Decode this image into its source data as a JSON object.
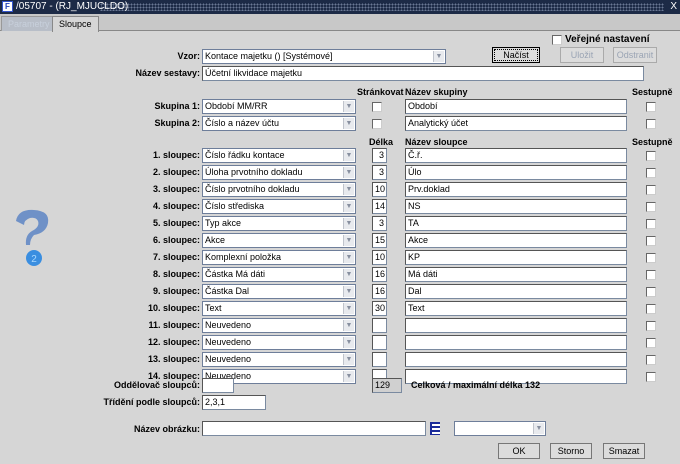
{
  "window": {
    "title": "/05707 - (RJ_MJUCLDO)",
    "icon": "app-logo",
    "close": "X"
  },
  "tabs": [
    {
      "label": "Parametry",
      "active": false
    },
    {
      "label": "Sloupce",
      "active": true
    }
  ],
  "public": {
    "label": "Veřejné nastavení",
    "checked": false
  },
  "vzor": {
    "label": "Vzor:",
    "value": "Kontace majetku   ()   [Systémové]"
  },
  "buttons": {
    "load": "Načíst",
    "save": "Uložit",
    "delete": "Odstranit",
    "ok": "OK",
    "cancel": "Storno",
    "clear": "Smazat"
  },
  "report_name": {
    "label": "Název sestavy:",
    "value": "Účetní likvidace majetku"
  },
  "group_headers": {
    "paginate": "Stránkovat",
    "group_name": "Název skupiny",
    "descending": "Sestupně"
  },
  "groups": [
    {
      "label": "Skupina 1:",
      "value": "Období MM/RR",
      "name": "Období"
    },
    {
      "label": "Skupina 2:",
      "value": "Číslo a název účtu",
      "name": "Analytický účet"
    }
  ],
  "column_headers": {
    "length": "Délka",
    "column_name": "Název sloupce",
    "descending": "Sestupně"
  },
  "columns": [
    {
      "label": "1. sloupec:",
      "value": "Číslo řádku kontace",
      "length": "3",
      "name": "Č.ř."
    },
    {
      "label": "2. sloupec:",
      "value": "Úloha prvotního dokladu",
      "length": "3",
      "name": "Úlo"
    },
    {
      "label": "3. sloupec:",
      "value": "Číslo prvotního dokladu",
      "length": "10",
      "name": "Prv.doklad"
    },
    {
      "label": "4. sloupec:",
      "value": "Číslo střediska",
      "length": "14",
      "name": "NS"
    },
    {
      "label": "5. sloupec:",
      "value": "Typ akce",
      "length": "3",
      "name": "TA"
    },
    {
      "label": "6. sloupec:",
      "value": "Akce",
      "length": "15",
      "name": "Akce"
    },
    {
      "label": "7. sloupec:",
      "value": "Komplexní položka",
      "length": "10",
      "name": "KP"
    },
    {
      "label": "8. sloupec:",
      "value": "Částka Má dáti",
      "length": "16",
      "name": "Má dáti"
    },
    {
      "label": "9. sloupec:",
      "value": "Částka Dal",
      "length": "16",
      "name": "Dal"
    },
    {
      "label": "10. sloupec:",
      "value": "Text",
      "length": "30",
      "name": "Text"
    },
    {
      "label": "11. sloupec:",
      "value": "Neuvedeno",
      "length": "",
      "name": ""
    },
    {
      "label": "12. sloupec:",
      "value": "Neuvedeno",
      "length": "",
      "name": ""
    },
    {
      "label": "13. sloupec:",
      "value": "Neuvedeno",
      "length": "",
      "name": ""
    },
    {
      "label": "14. sloupec:",
      "value": "Neuvedeno",
      "length": "",
      "name": ""
    }
  ],
  "separator": {
    "label": "Oddělovač sloupců:",
    "value": ""
  },
  "total": {
    "value": "129",
    "label": "Celková / maximální délka 132"
  },
  "sort": {
    "label": "Třídění podle sloupců:",
    "value": "2,3,1"
  },
  "image": {
    "label": "Název obrázku:",
    "value": "",
    "icon": "list-icon",
    "combo_value": ""
  },
  "help_icon": "question-mark-icon"
}
